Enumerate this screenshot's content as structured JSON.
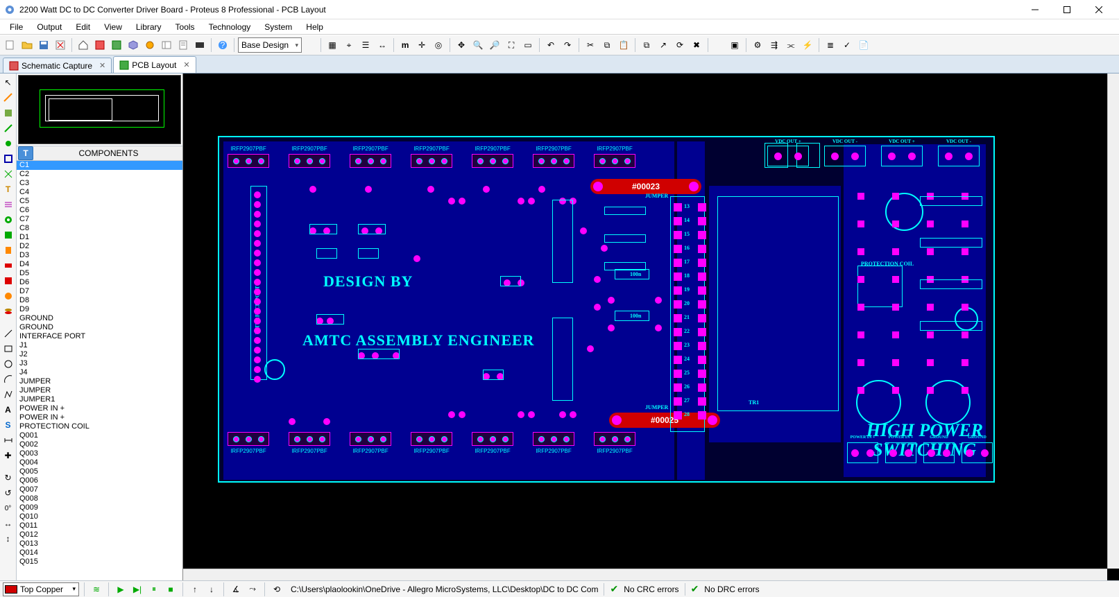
{
  "window": {
    "title": "2200 Watt DC to DC Converter Driver Board - Proteus 8 Professional - PCB Layout"
  },
  "menu": {
    "items": [
      "File",
      "Output",
      "Edit",
      "View",
      "Library",
      "Tools",
      "Technology",
      "System",
      "Help"
    ]
  },
  "toolbar": {
    "design_variant": "Base Design"
  },
  "tabs": {
    "schematic": "Schematic Capture",
    "pcb": "PCB Layout"
  },
  "sidepanel": {
    "components_header": "COMPONENTS",
    "items": [
      "C1",
      "C2",
      "C3",
      "C4",
      "C5",
      "C6",
      "C7",
      "C8",
      "D1",
      "D2",
      "D3",
      "D4",
      "D5",
      "D6",
      "D7",
      "D8",
      "D9",
      "GROUND",
      "GROUND",
      "INTERFACE PORT",
      "J1",
      "J2",
      "J3",
      "J4",
      "JUMPER",
      "JUMPER",
      "JUMPER1",
      "POWER IN +",
      "POWER IN +",
      "PROTECTION COIL",
      "Q001",
      "Q002",
      "Q003",
      "Q004",
      "Q005",
      "Q006",
      "Q007",
      "Q008",
      "Q009",
      "Q010",
      "Q011",
      "Q012",
      "Q013",
      "Q014",
      "Q015"
    ],
    "selected": "C1"
  },
  "pcb": {
    "text_design_by": "DESIGN BY",
    "text_company": "AMTC ASSEMBLY ENGINEER",
    "text_hps1": "HIGH POWER",
    "text_hps2": "SWITCHING",
    "track1": "#00023",
    "track2": "#00025",
    "chip_label_top": "IRFP2907PBF",
    "chip_label_bot": "IRFP2907PBF",
    "silk_interface": "INTERFACE PORT",
    "silk_jumper": "JUMPER",
    "silk_100n": "100n",
    "silk_prot": "PROTECTION COIL",
    "silk_tr1": "TR1",
    "silk_vdc_out_plus": "VDC OUT +",
    "silk_vdc_out_minus": "VDC OUT -",
    "silk_power_in": "POWER IN +",
    "silk_ground": "GROUND"
  },
  "footer": {
    "layer": "Top Copper",
    "path": "C:\\Users\\plaolookin\\OneDrive - Allegro MicroSystems, LLC\\Desktop\\DC to DC Com",
    "crc": "No CRC errors",
    "drc": "No DRC errors"
  }
}
